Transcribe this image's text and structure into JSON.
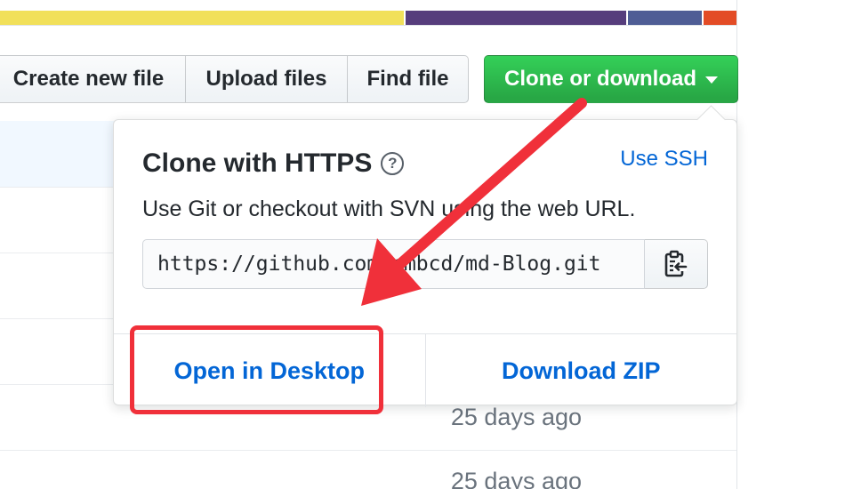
{
  "language_bar": {
    "colors": [
      "#f1e05a",
      "#563d7c",
      "#4f5d95",
      "#e34c26"
    ],
    "fractions": [
      0.55,
      0.3,
      0.1,
      0.045
    ]
  },
  "toolbar": {
    "create_new_file": "Create new file",
    "upload_files": "Upload files",
    "find_file": "Find file",
    "clone_or_download": "Clone or download"
  },
  "clone_popover": {
    "title": "Clone with HTTPS",
    "help_glyph": "?",
    "use_ssh": "Use SSH",
    "description": "Use Git or checkout with SVN using the web URL.",
    "url": "https://github.com/cmbcd/md-Blog.git",
    "copy_icon": "clipboard-icon",
    "open_in_desktop": "Open in Desktop",
    "download_zip": "Download ZIP"
  },
  "file_rows": [
    {
      "time": "25 days ago"
    },
    {
      "time": "25 days ago"
    }
  ],
  "colors": {
    "clone_green": "#28a745",
    "link_blue": "#0366d6",
    "annotation_red": "#f0303a"
  }
}
